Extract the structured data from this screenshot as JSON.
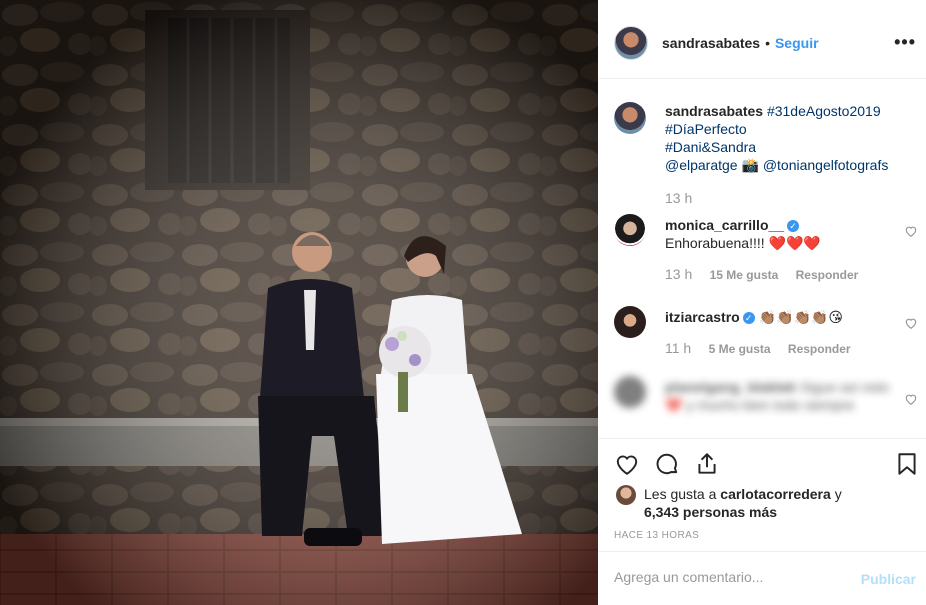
{
  "post": {
    "author": "sandrasabates",
    "separator": "•",
    "follow_label": "Seguir",
    "more_label": "•••",
    "caption": {
      "hashtag_date": "#31deAgosto2019",
      "hashtag_perfect": "#DíaPerfecto",
      "hashtag_names": "#Dani&Sandra",
      "mention_1": "@elparatge",
      "camera_emoji": "📸",
      "mention_2": "@toniangelfotografs",
      "time": "13 h"
    }
  },
  "comments": [
    {
      "user": "monica_carrillo__",
      "text": "Enhorabuena!!!! ❤️❤️❤️",
      "time": "13 h",
      "likes": "15 Me gusta",
      "reply": "Responder"
    },
    {
      "user": "itziarcastro",
      "text": "👏🏽👏🏽👏🏽👏🏽😘",
      "time": "11 h",
      "likes": "5 Me gusta",
      "reply": "Responder"
    },
    {
      "user": "planetgang_blablah",
      "text": "Sigue así esto ❤️ y mucho bien todo siempre",
      "blurred": true
    }
  ],
  "actions": {
    "likes_prefix": "Les gusta a",
    "likes_user": "carlotacorredera",
    "likes_and": "y",
    "likes_count": "6,343 personas más",
    "time_ago": "HACE 13 HORAS"
  },
  "add_comment": {
    "placeholder": "Agrega un comentario...",
    "post_label": "Publicar"
  },
  "colors": {
    "link_blue": "#3897f0",
    "heart_red": "#ed4956",
    "muted": "#999999"
  },
  "icons": [
    "heart-icon",
    "comment-icon",
    "share-icon",
    "bookmark-icon",
    "verified-icon"
  ]
}
